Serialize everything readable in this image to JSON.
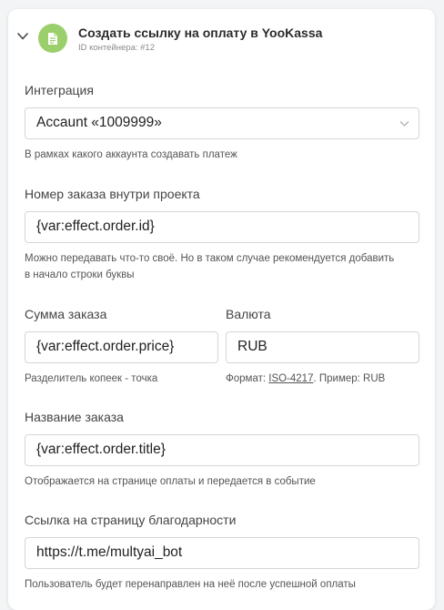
{
  "header": {
    "title": "Создать ссылку на оплату в YooKassa",
    "container_id_label": "ID контейнера: #12",
    "badge_color": "#9bcf6c",
    "badge_icon": "document-icon",
    "collapse_icon": "chevron-down-icon"
  },
  "integration": {
    "label": "Интеграция",
    "value": "Accaunt «1009999»",
    "hint": "В рамках какого аккаунта создавать платеж"
  },
  "order_number": {
    "label": "Номер заказа внутри проекта",
    "value": "{var:effect.order.id}",
    "hint_line1": "Можно передавать что-то своё. Но в таком случае рекомендуется добавить",
    "hint_line2": "в начало строки буквы"
  },
  "order_amount": {
    "label": "Сумма заказа",
    "value": "{var:effect.order.price}",
    "hint": "Разделитель копеек - точка"
  },
  "currency": {
    "label": "Валюта",
    "value": "RUB",
    "hint_prefix": "Формат: ",
    "hint_link": "ISO-4217",
    "hint_suffix": ". Пример: RUB"
  },
  "order_title": {
    "label": "Название заказа",
    "value": "{var:effect.order.title}",
    "hint": "Отображается на странице оплаты и передается в событие"
  },
  "thank_you_link": {
    "label": "Ссылка на страницу благодарности",
    "value": "https://t.me/multyai_bot",
    "hint": "Пользователь будет перенаправлен на неё после успешной оплаты"
  }
}
